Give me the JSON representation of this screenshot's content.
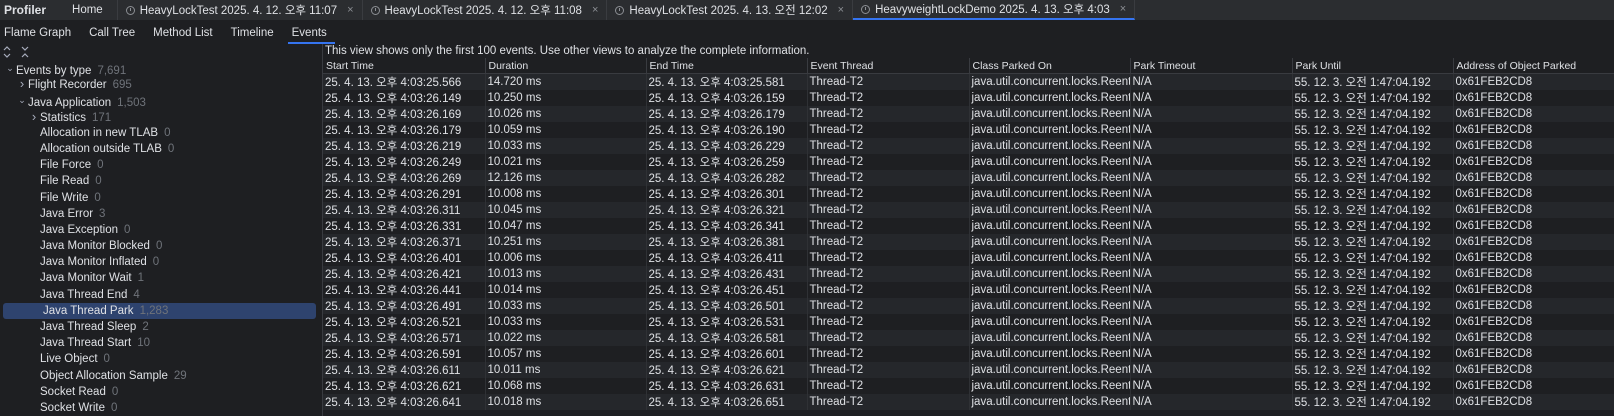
{
  "app": {
    "title": "Profiler"
  },
  "file_tabs": [
    {
      "label": "Home",
      "clock": false,
      "closable": false,
      "active": false
    },
    {
      "label": "HeavyLockTest 2025. 4. 12. 오후 11:07",
      "clock": true,
      "closable": true,
      "active": false
    },
    {
      "label": "HeavyLockTest 2025. 4. 12. 오후 11:08",
      "clock": true,
      "closable": true,
      "active": false
    },
    {
      "label": "HeavyLockTest 2025. 4. 13. 오전 12:02",
      "clock": true,
      "closable": true,
      "active": false
    },
    {
      "label": "HeavyweightLockDemo 2025. 4. 13. 오후 4:03",
      "clock": true,
      "closable": true,
      "active": true
    }
  ],
  "close_glyph": "×",
  "view_tabs": [
    {
      "label": "Flame Graph",
      "active": false
    },
    {
      "label": "Call Tree",
      "active": false
    },
    {
      "label": "Method List",
      "active": false
    },
    {
      "label": "Timeline",
      "active": false
    },
    {
      "label": "Events",
      "active": true
    }
  ],
  "tree_tools": {
    "expand_icon": "expand-all-icon",
    "collapse_icon": "collapse-all-icon"
  },
  "tree": [
    {
      "label": "Events by type",
      "count": "7,691",
      "level": 0,
      "arrow": "down",
      "selected": false
    },
    {
      "label": "Flight Recorder",
      "count": "695",
      "level": 1,
      "arrow": "right",
      "selected": false
    },
    {
      "label": "Java Application",
      "count": "1,503",
      "level": 1,
      "arrow": "down",
      "selected": false
    },
    {
      "label": "Statistics",
      "count": "171",
      "level": 2,
      "arrow": "right",
      "selected": false
    },
    {
      "label": "Allocation in new TLAB",
      "count": "0",
      "level": 2,
      "arrow": "none",
      "selected": false
    },
    {
      "label": "Allocation outside TLAB",
      "count": "0",
      "level": 2,
      "arrow": "none",
      "selected": false
    },
    {
      "label": "File Force",
      "count": "0",
      "level": 2,
      "arrow": "none",
      "selected": false
    },
    {
      "label": "File Read",
      "count": "0",
      "level": 2,
      "arrow": "none",
      "selected": false
    },
    {
      "label": "File Write",
      "count": "0",
      "level": 2,
      "arrow": "none",
      "selected": false
    },
    {
      "label": "Java Error",
      "count": "3",
      "level": 2,
      "arrow": "none",
      "selected": false
    },
    {
      "label": "Java Exception",
      "count": "0",
      "level": 2,
      "arrow": "none",
      "selected": false
    },
    {
      "label": "Java Monitor Blocked",
      "count": "0",
      "level": 2,
      "arrow": "none",
      "selected": false
    },
    {
      "label": "Java Monitor Inflated",
      "count": "0",
      "level": 2,
      "arrow": "none",
      "selected": false
    },
    {
      "label": "Java Monitor Wait",
      "count": "1",
      "level": 2,
      "arrow": "none",
      "selected": false
    },
    {
      "label": "Java Thread End",
      "count": "4",
      "level": 2,
      "arrow": "none",
      "selected": false
    },
    {
      "label": "Java Thread Park",
      "count": "1,283",
      "level": 2,
      "arrow": "none",
      "selected": true
    },
    {
      "label": "Java Thread Sleep",
      "count": "2",
      "level": 2,
      "arrow": "none",
      "selected": false
    },
    {
      "label": "Java Thread Start",
      "count": "10",
      "level": 2,
      "arrow": "none",
      "selected": false
    },
    {
      "label": "Live Object",
      "count": "0",
      "level": 2,
      "arrow": "none",
      "selected": false
    },
    {
      "label": "Object Allocation Sample",
      "count": "29",
      "level": 2,
      "arrow": "none",
      "selected": false
    },
    {
      "label": "Socket Read",
      "count": "0",
      "level": 2,
      "arrow": "none",
      "selected": false
    },
    {
      "label": "Socket Write",
      "count": "0",
      "level": 2,
      "arrow": "none",
      "selected": false
    }
  ],
  "notice": "This view shows only the first 100 events. Use other views to analyze the complete information.",
  "table": {
    "columns": [
      "Start Time",
      "Duration",
      "End Time",
      "Event Thread",
      "Class Parked On",
      "Park Timeout",
      "Park Until",
      "Address of Object Parked"
    ],
    "rows": [
      [
        "25. 4. 13. 오후 4:03:25.566",
        "14.720 ms",
        "25. 4. 13. 오후 4:03:25.581",
        "Thread-T2",
        "java.util.concurrent.locks.ReentrantLock",
        "N/A",
        "55. 12. 3. 오전 1:47:04.192",
        "0x61FEB2CD8"
      ],
      [
        "25. 4. 13. 오후 4:03:26.149",
        "10.250 ms",
        "25. 4. 13. 오후 4:03:26.159",
        "Thread-T2",
        "java.util.concurrent.locks.ReentrantLock",
        "N/A",
        "55. 12. 3. 오전 1:47:04.192",
        "0x61FEB2CD8"
      ],
      [
        "25. 4. 13. 오후 4:03:26.169",
        "10.026 ms",
        "25. 4. 13. 오후 4:03:26.179",
        "Thread-T2",
        "java.util.concurrent.locks.ReentrantLock",
        "N/A",
        "55. 12. 3. 오전 1:47:04.192",
        "0x61FEB2CD8"
      ],
      [
        "25. 4. 13. 오후 4:03:26.179",
        "10.059 ms",
        "25. 4. 13. 오후 4:03:26.190",
        "Thread-T2",
        "java.util.concurrent.locks.ReentrantLock",
        "N/A",
        "55. 12. 3. 오전 1:47:04.192",
        "0x61FEB2CD8"
      ],
      [
        "25. 4. 13. 오후 4:03:26.219",
        "10.033 ms",
        "25. 4. 13. 오후 4:03:26.229",
        "Thread-T2",
        "java.util.concurrent.locks.ReentrantLock",
        "N/A",
        "55. 12. 3. 오전 1:47:04.192",
        "0x61FEB2CD8"
      ],
      [
        "25. 4. 13. 오후 4:03:26.249",
        "10.021 ms",
        "25. 4. 13. 오후 4:03:26.259",
        "Thread-T2",
        "java.util.concurrent.locks.ReentrantLock",
        "N/A",
        "55. 12. 3. 오전 1:47:04.192",
        "0x61FEB2CD8"
      ],
      [
        "25. 4. 13. 오후 4:03:26.269",
        "12.126 ms",
        "25. 4. 13. 오후 4:03:26.282",
        "Thread-T2",
        "java.util.concurrent.locks.ReentrantLock",
        "N/A",
        "55. 12. 3. 오전 1:47:04.192",
        "0x61FEB2CD8"
      ],
      [
        "25. 4. 13. 오후 4:03:26.291",
        "10.008 ms",
        "25. 4. 13. 오후 4:03:26.301",
        "Thread-T2",
        "java.util.concurrent.locks.ReentrantLock",
        "N/A",
        "55. 12. 3. 오전 1:47:04.192",
        "0x61FEB2CD8"
      ],
      [
        "25. 4. 13. 오후 4:03:26.311",
        "10.045 ms",
        "25. 4. 13. 오후 4:03:26.321",
        "Thread-T2",
        "java.util.concurrent.locks.ReentrantLock",
        "N/A",
        "55. 12. 3. 오전 1:47:04.192",
        "0x61FEB2CD8"
      ],
      [
        "25. 4. 13. 오후 4:03:26.331",
        "10.047 ms",
        "25. 4. 13. 오후 4:03:26.341",
        "Thread-T2",
        "java.util.concurrent.locks.ReentrantLock",
        "N/A",
        "55. 12. 3. 오전 1:47:04.192",
        "0x61FEB2CD8"
      ],
      [
        "25. 4. 13. 오후 4:03:26.371",
        "10.251 ms",
        "25. 4. 13. 오후 4:03:26.381",
        "Thread-T2",
        "java.util.concurrent.locks.ReentrantLock",
        "N/A",
        "55. 12. 3. 오전 1:47:04.192",
        "0x61FEB2CD8"
      ],
      [
        "25. 4. 13. 오후 4:03:26.401",
        "10.006 ms",
        "25. 4. 13. 오후 4:03:26.411",
        "Thread-T2",
        "java.util.concurrent.locks.ReentrantLock",
        "N/A",
        "55. 12. 3. 오전 1:47:04.192",
        "0x61FEB2CD8"
      ],
      [
        "25. 4. 13. 오후 4:03:26.421",
        "10.013 ms",
        "25. 4. 13. 오후 4:03:26.431",
        "Thread-T2",
        "java.util.concurrent.locks.ReentrantLock",
        "N/A",
        "55. 12. 3. 오전 1:47:04.192",
        "0x61FEB2CD8"
      ],
      [
        "25. 4. 13. 오후 4:03:26.441",
        "10.014 ms",
        "25. 4. 13. 오후 4:03:26.451",
        "Thread-T2",
        "java.util.concurrent.locks.ReentrantLock",
        "N/A",
        "55. 12. 3. 오전 1:47:04.192",
        "0x61FEB2CD8"
      ],
      [
        "25. 4. 13. 오후 4:03:26.491",
        "10.033 ms",
        "25. 4. 13. 오후 4:03:26.501",
        "Thread-T2",
        "java.util.concurrent.locks.ReentrantLock",
        "N/A",
        "55. 12. 3. 오전 1:47:04.192",
        "0x61FEB2CD8"
      ],
      [
        "25. 4. 13. 오후 4:03:26.521",
        "10.033 ms",
        "25. 4. 13. 오후 4:03:26.531",
        "Thread-T2",
        "java.util.concurrent.locks.ReentrantLock",
        "N/A",
        "55. 12. 3. 오전 1:47:04.192",
        "0x61FEB2CD8"
      ],
      [
        "25. 4. 13. 오후 4:03:26.571",
        "10.022 ms",
        "25. 4. 13. 오후 4:03:26.581",
        "Thread-T2",
        "java.util.concurrent.locks.ReentrantLock",
        "N/A",
        "55. 12. 3. 오전 1:47:04.192",
        "0x61FEB2CD8"
      ],
      [
        "25. 4. 13. 오후 4:03:26.591",
        "10.057 ms",
        "25. 4. 13. 오후 4:03:26.601",
        "Thread-T2",
        "java.util.concurrent.locks.ReentrantLock",
        "N/A",
        "55. 12. 3. 오전 1:47:04.192",
        "0x61FEB2CD8"
      ],
      [
        "25. 4. 13. 오후 4:03:26.611",
        "10.011 ms",
        "25. 4. 13. 오후 4:03:26.621",
        "Thread-T2",
        "java.util.concurrent.locks.ReentrantLock",
        "N/A",
        "55. 12. 3. 오전 1:47:04.192",
        "0x61FEB2CD8"
      ],
      [
        "25. 4. 13. 오후 4:03:26.621",
        "10.068 ms",
        "25. 4. 13. 오후 4:03:26.631",
        "Thread-T2",
        "java.util.concurrent.locks.ReentrantLock",
        "N/A",
        "55. 12. 3. 오전 1:47:04.192",
        "0x61FEB2CD8"
      ],
      [
        "25. 4. 13. 오후 4:03:26.641",
        "10.018 ms",
        "25. 4. 13. 오후 4:03:26.651",
        "Thread-T2",
        "java.util.concurrent.locks.ReentrantLock",
        "N/A",
        "55. 12. 3. 오전 1:47:04.192",
        "0x61FEB2CD8"
      ]
    ]
  }
}
